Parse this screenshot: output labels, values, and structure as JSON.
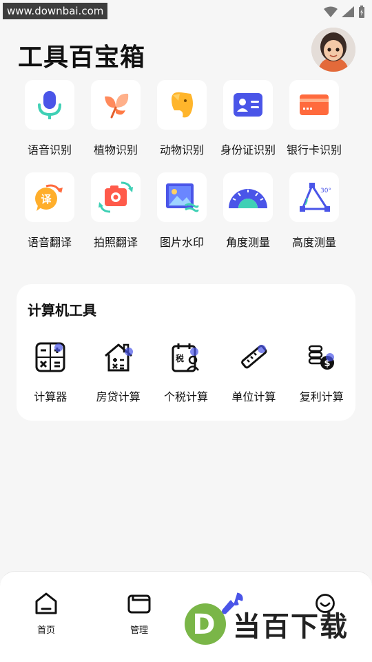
{
  "watermark_top": "www.downbai.com",
  "header": {
    "title": "工具百宝箱"
  },
  "tools_row1": [
    {
      "label": "语音识别",
      "icon": "microphone-icon"
    },
    {
      "label": "植物识别",
      "icon": "leaf-icon"
    },
    {
      "label": "动物识别",
      "icon": "elephant-icon"
    },
    {
      "label": "身份证识别",
      "icon": "id-card-icon"
    },
    {
      "label": "银行卡识别",
      "icon": "bank-card-icon"
    }
  ],
  "tools_row2": [
    {
      "label": "语音翻译",
      "icon": "translate-bubble-icon",
      "glyph": "译"
    },
    {
      "label": "拍照翻译",
      "icon": "camera-translate-icon"
    },
    {
      "label": "图片水印",
      "icon": "image-watermark-icon"
    },
    {
      "label": "角度测量",
      "icon": "protractor-icon"
    },
    {
      "label": "高度测量",
      "icon": "height-triangle-icon",
      "glyph": "30°"
    }
  ],
  "calculator": {
    "title": "计算机工具",
    "items": [
      {
        "label": "计算器",
        "icon": "calculator-icon"
      },
      {
        "label": "房贷计算",
        "icon": "house-calc-icon"
      },
      {
        "label": "个税计算",
        "icon": "tax-calc-icon",
        "glyph": "税"
      },
      {
        "label": "单位计算",
        "icon": "ruler-icon"
      },
      {
        "label": "复利计算",
        "icon": "coins-icon",
        "glyph": "$"
      }
    ]
  },
  "nav": [
    {
      "label": "首页",
      "icon": "home-icon"
    },
    {
      "label": "管理",
      "icon": "folder-icon"
    },
    {
      "label": "",
      "icon": "wrench-icon"
    },
    {
      "label": "",
      "icon": "smile-icon"
    }
  ],
  "brand_watermark": {
    "letter": "D",
    "text": "当百下载"
  },
  "colors": {
    "accent": "#4a55e8",
    "orange": "#ff8a3d",
    "teal": "#3fd0b5",
    "background": "#f6f6f6"
  }
}
